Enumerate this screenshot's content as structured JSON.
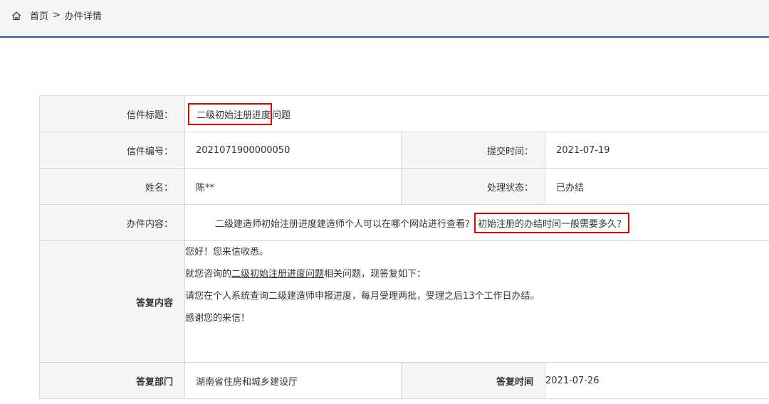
{
  "breadcrumb": {
    "home_label": "首页",
    "separator": ">",
    "current": "办件详情"
  },
  "detail": {
    "title_label": "信件标题：",
    "title_highlight": "二级初始注册进度",
    "title_rest": "问题",
    "number_label": "信件编号：",
    "number_value": "2021071900000050",
    "submit_time_label": "提交时间：",
    "submit_time_value": "2021-07-19",
    "name_label": "姓名：",
    "name_value": "陈**",
    "status_label": "处理状态：",
    "status_value": "已办结",
    "content_label": "办件内容：",
    "content_plain": "二级建造师初始注册进度建造师个人可以在哪个网站进行查看？",
    "content_highlight": "初始注册的办结时间一般需要多久？",
    "reply_label": "答复内容",
    "reply_line1": "您好！您来信收悉。",
    "reply_line2_pre": "就您咨询的",
    "reply_line2_link": "二级初始注册进度问题",
    "reply_line2_post": "相关问题，现答复如下：",
    "reply_line3": "请您在个人系统查询二级建造师申报进度，每月受理两批，受理之后13个工作日办结。",
    "reply_line4": "感谢您的来信！",
    "dept_label": "答复部门",
    "dept_value": "湖南省住房和城乡建设厅",
    "reply_time_label": "答复时间",
    "reply_time_value": "2021-07-26"
  },
  "colors": {
    "accent_border": "#1f5fa6",
    "highlight": "#e00000"
  }
}
